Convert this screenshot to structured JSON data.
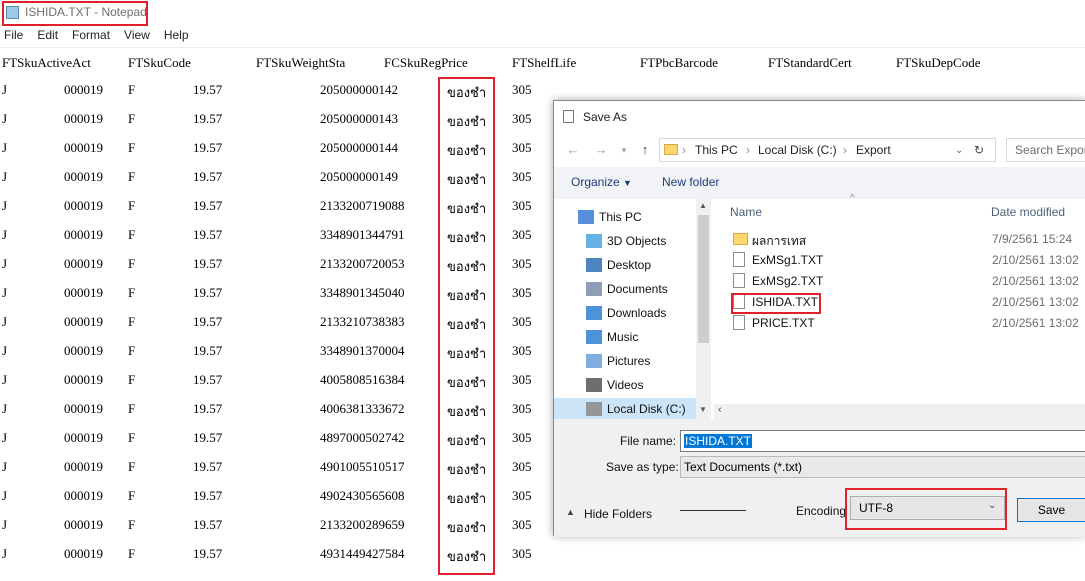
{
  "notepad": {
    "title": "ISHIDA.TXT - Notepad",
    "menu": [
      "File",
      "Edit",
      "Format",
      "View",
      "Help"
    ]
  },
  "editor": {
    "headers": [
      "FTSkuActiveAct",
      "FTSkuCode",
      "FTSkuWeightSta",
      "FCSkuRegPrice",
      "FTShelfLife",
      "FTPbcBarcode",
      "FTStandardCert",
      "FTSkuDepCode"
    ],
    "rows": [
      [
        "J",
        "000019",
        "F",
        "19.57",
        "205000000142",
        "ของชำ",
        "305"
      ],
      [
        "J",
        "000019",
        "F",
        "19.57",
        "205000000143",
        "ของชำ",
        "305"
      ],
      [
        "J",
        "000019",
        "F",
        "19.57",
        "205000000144",
        "ของชำ",
        "305"
      ],
      [
        "J",
        "000019",
        "F",
        "19.57",
        "205000000149",
        "ของชำ",
        "305"
      ],
      [
        "J",
        "000019",
        "F",
        "19.57",
        "2133200719088",
        "ของชำ",
        "305"
      ],
      [
        "J",
        "000019",
        "F",
        "19.57",
        "3348901344791",
        "ของชำ",
        "305"
      ],
      [
        "J",
        "000019",
        "F",
        "19.57",
        "2133200720053",
        "ของชำ",
        "305"
      ],
      [
        "J",
        "000019",
        "F",
        "19.57",
        "3348901345040",
        "ของชำ",
        "305"
      ],
      [
        "J",
        "000019",
        "F",
        "19.57",
        "2133210738383",
        "ของชำ",
        "305"
      ],
      [
        "J",
        "000019",
        "F",
        "19.57",
        "3348901370004",
        "ของชำ",
        "305"
      ],
      [
        "J",
        "000019",
        "F",
        "19.57",
        "4005808516384",
        "ของชำ",
        "305"
      ],
      [
        "J",
        "000019",
        "F",
        "19.57",
        "4006381333672",
        "ของชำ",
        "305"
      ],
      [
        "J",
        "000019",
        "F",
        "19.57",
        "4897000502742",
        "ของชำ",
        "305"
      ],
      [
        "J",
        "000019",
        "F",
        "19.57",
        "4901005510517",
        "ของชำ",
        "305"
      ],
      [
        "J",
        "000019",
        "F",
        "19.57",
        "4902430565608",
        "ของชำ",
        "305"
      ],
      [
        "J",
        "000019",
        "F",
        "19.57",
        "2133200289659",
        "ของชำ",
        "305"
      ],
      [
        "J",
        "000019",
        "F",
        "19.57",
        "4931449427584",
        "ของชำ",
        "305"
      ]
    ]
  },
  "dialog": {
    "title": "Save As",
    "breadcrumb": [
      "This PC",
      "Local Disk (C:)",
      "Export"
    ],
    "search_placeholder": "Search Export",
    "organize": "Organize",
    "new_folder": "New folder",
    "nav_items": [
      {
        "label": "This PC",
        "icon": "computer-icon"
      },
      {
        "label": "3D Objects",
        "icon": "cube-icon"
      },
      {
        "label": "Desktop",
        "icon": "desktop-icon"
      },
      {
        "label": "Documents",
        "icon": "documents-icon"
      },
      {
        "label": "Downloads",
        "icon": "download-icon"
      },
      {
        "label": "Music",
        "icon": "music-icon"
      },
      {
        "label": "Pictures",
        "icon": "pictures-icon"
      },
      {
        "label": "Videos",
        "icon": "videos-icon"
      },
      {
        "label": "Local Disk (C:)",
        "icon": "disk-icon"
      }
    ],
    "columns": {
      "name": "Name",
      "date": "Date modified"
    },
    "files": [
      {
        "name": "ผลการเทส",
        "date": "7/9/2561 15:24",
        "type": "folder"
      },
      {
        "name": "ExMSg1.TXT",
        "date": "2/10/2561 13:02",
        "type": "file"
      },
      {
        "name": "ExMSg2.TXT",
        "date": "2/10/2561 13:02",
        "type": "file"
      },
      {
        "name": "ISHIDA.TXT",
        "date": "2/10/2561 13:02",
        "type": "file"
      },
      {
        "name": "PRICE.TXT",
        "date": "2/10/2561 13:02",
        "type": "file"
      }
    ],
    "file_name_label": "File name:",
    "file_name_value": "ISHIDA.TXT",
    "save_type_label": "Save as type:",
    "save_type_value": "Text Documents (*.txt)",
    "hide_folders": "Hide Folders",
    "encoding_label": "Encoding",
    "encoding_value": "UTF-8",
    "save_label": "Save"
  }
}
